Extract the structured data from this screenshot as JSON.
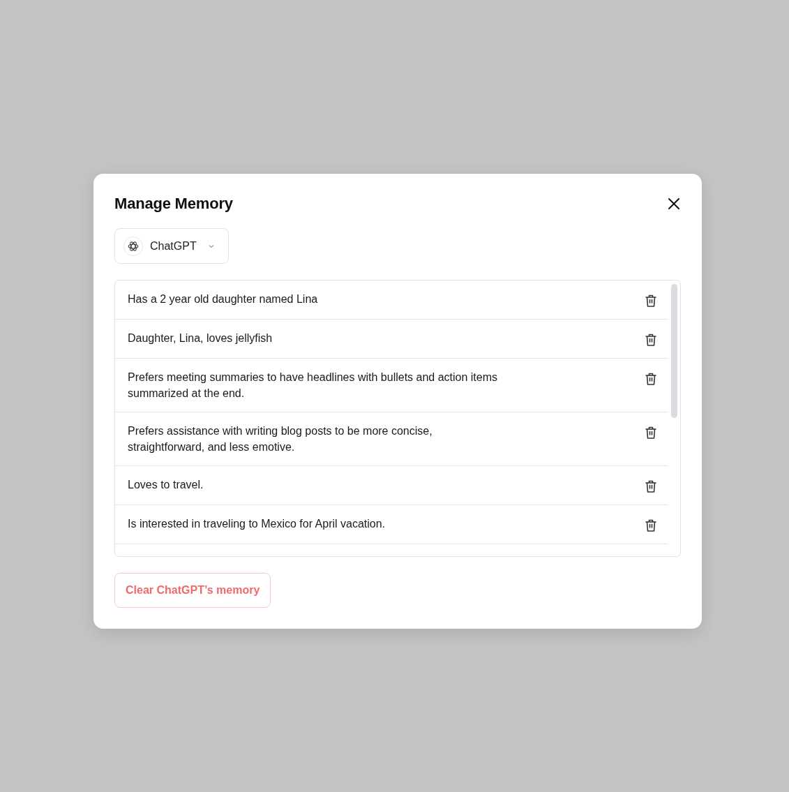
{
  "dialog": {
    "title": "Manage Memory"
  },
  "model_selector": {
    "label": "ChatGPT"
  },
  "memories": [
    {
      "text": "Has a 2 year old daughter named Lina"
    },
    {
      "text": "Daughter, Lina, loves jellyfish"
    },
    {
      "text": "Prefers meeting summaries to have headlines with bullets and action items summarized at the end."
    },
    {
      "text": "Prefers assistance with writing blog posts to be more concise, straightforward, and less emotive."
    },
    {
      "text": "Loves to travel."
    },
    {
      "text": "Is interested in traveling to Mexico for April vacation."
    }
  ],
  "clear_button": {
    "label": "Clear ChatGPT’s memory"
  }
}
